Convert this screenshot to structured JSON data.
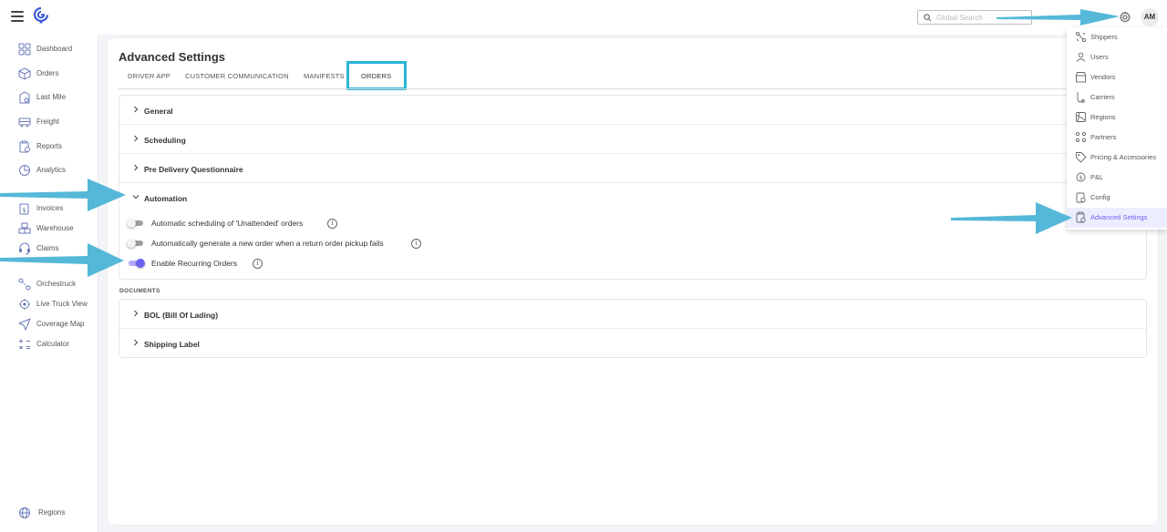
{
  "topbar": {
    "search_placeholder": "Global Search",
    "avatar_initials": "AM"
  },
  "sidebar": {
    "items": [
      {
        "label": "Dashboard",
        "icon": "dashboard-icon"
      },
      {
        "label": "Orders",
        "icon": "orders-icon"
      },
      {
        "label": "Last Mile",
        "icon": "last-mile-icon"
      },
      {
        "label": "Freight",
        "icon": "freight-icon"
      },
      {
        "label": "Reports",
        "icon": "reports-icon"
      },
      {
        "label": "Analytics",
        "icon": "analytics-icon"
      },
      {
        "label": "Invoices",
        "icon": "invoices-icon"
      },
      {
        "label": "Warehouse",
        "icon": "warehouse-icon"
      },
      {
        "label": "Claims",
        "icon": "claims-icon"
      },
      {
        "label": "Orchestruck",
        "icon": "orchestruck-icon"
      },
      {
        "label": "Live Truck View",
        "icon": "live-truck-icon"
      },
      {
        "label": "Coverage Map",
        "icon": "coverage-map-icon"
      },
      {
        "label": "Calculator",
        "icon": "calculator-icon"
      }
    ],
    "bottom_item": {
      "label": "Regions",
      "icon": "globe-icon"
    }
  },
  "main": {
    "title": "Advanced Settings",
    "tabs": [
      {
        "label": "DRIVER APP"
      },
      {
        "label": "CUSTOMER COMMUNICATION"
      },
      {
        "label": "MANIFESTS"
      },
      {
        "label": "ORDERS",
        "active": true
      }
    ],
    "sections": [
      {
        "label": "General"
      },
      {
        "label": "Scheduling"
      },
      {
        "label": "Pre Delivery Questionnaire"
      },
      {
        "label": "Automation",
        "expanded": true
      }
    ],
    "automation_toggles": [
      {
        "label": "Automatic scheduling of 'Unattended' orders",
        "on": false
      },
      {
        "label": "Automatically generate a new order when a return order pickup fails",
        "on": false
      },
      {
        "label": "Enable Recurring Orders",
        "on": true
      }
    ],
    "documents_label": "DOCUMENTS",
    "documents_sections": [
      {
        "label": "BOL (Bill Of Lading)"
      },
      {
        "label": "Shipping Label"
      }
    ]
  },
  "settings_menu": {
    "items": [
      {
        "label": "Shippers",
        "icon": "shippers-icon"
      },
      {
        "label": "Users",
        "icon": "users-icon"
      },
      {
        "label": "Vendors",
        "icon": "vendors-icon"
      },
      {
        "label": "Carriers",
        "icon": "carriers-icon"
      },
      {
        "label": "Regions",
        "icon": "regions-icon"
      },
      {
        "label": "Partners",
        "icon": "partners-icon"
      },
      {
        "label": "Pricing & Accessories",
        "icon": "pricing-tag-icon"
      },
      {
        "label": "P&L",
        "icon": "profit-loss-icon"
      },
      {
        "label": "Config",
        "icon": "config-icon"
      },
      {
        "label": "Advanced Settings",
        "icon": "advanced-settings-icon",
        "active": true
      }
    ]
  },
  "colors": {
    "accent": "#6c63f0",
    "annotation": "#29b6d6",
    "toggle_off": "#9e9e9e"
  }
}
